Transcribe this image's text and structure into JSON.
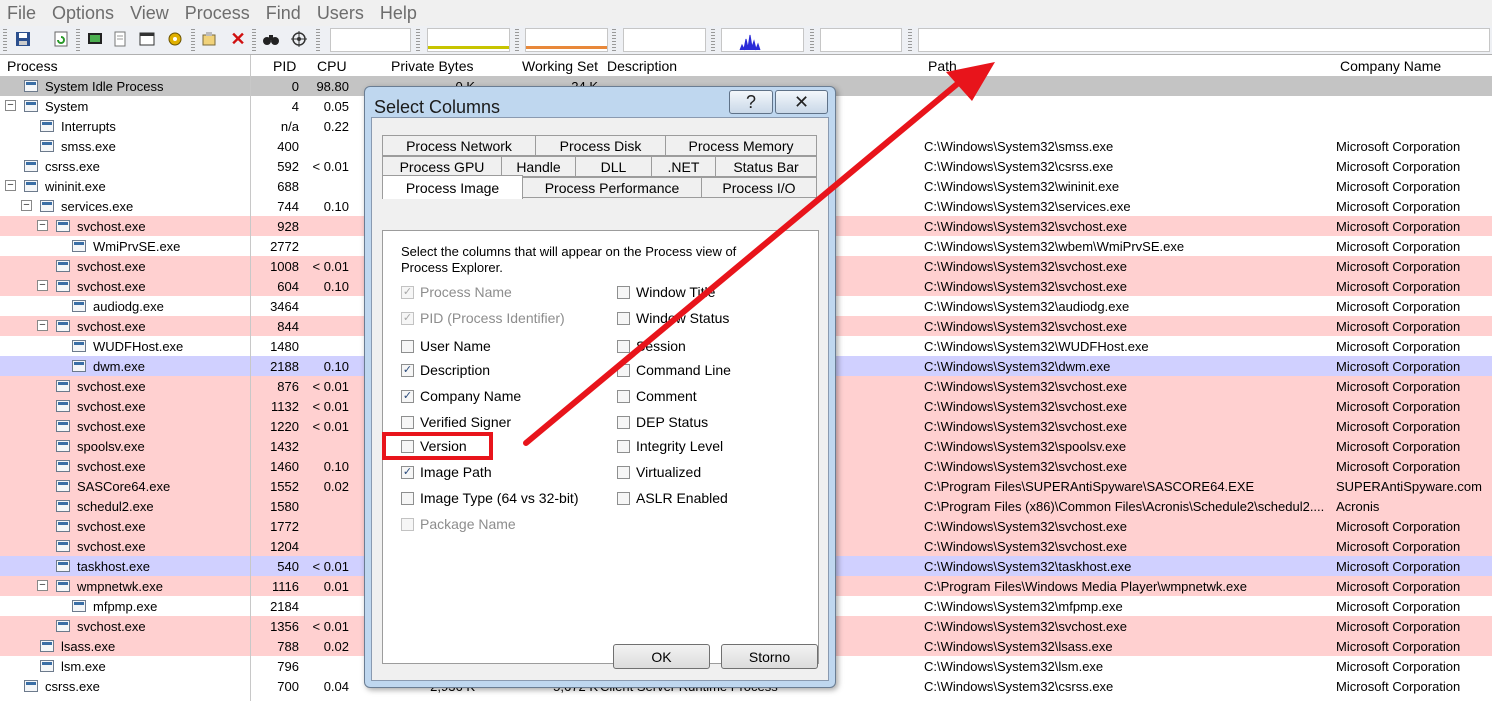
{
  "menu": [
    "File",
    "Options",
    "View",
    "Process",
    "Find",
    "Users",
    "Help"
  ],
  "columns": {
    "process": "Process",
    "pid": "PID",
    "cpu": "CPU",
    "private_bytes": "Private Bytes",
    "working_set": "Working Set",
    "description": "Description",
    "path": "Path",
    "company": "Company Name"
  },
  "processes": [
    {
      "name": "System Idle Process",
      "pid": "0",
      "cpu": "98.80",
      "priv": "0 K",
      "ws": "24 K",
      "desc": "",
      "path": "",
      "company": "",
      "tone": "gray",
      "depth": 1,
      "exp": ""
    },
    {
      "name": "System",
      "pid": "4",
      "cpu": "0.05",
      "priv": "",
      "ws": "",
      "desc": "",
      "path": "",
      "company": "",
      "tone": "",
      "depth": 1,
      "exp": "−"
    },
    {
      "name": "Interrupts",
      "pid": "n/a",
      "cpu": "0.22",
      "priv": "",
      "ws": "",
      "desc": "",
      "path": "",
      "company": "",
      "tone": "",
      "depth": 2,
      "exp": ""
    },
    {
      "name": "smss.exe",
      "pid": "400",
      "cpu": "",
      "priv": "",
      "ws": "",
      "desc": "",
      "path": "C:\\Windows\\System32\\smss.exe",
      "company": "Microsoft Corporation",
      "tone": "",
      "depth": 2,
      "exp": ""
    },
    {
      "name": "csrss.exe",
      "pid": "592",
      "cpu": "< 0.01",
      "priv": "",
      "ws": "",
      "desc": "",
      "path": "C:\\Windows\\System32\\csrss.exe",
      "company": "Microsoft Corporation",
      "tone": "",
      "depth": 1,
      "exp": ""
    },
    {
      "name": "wininit.exe",
      "pid": "688",
      "cpu": "",
      "priv": "",
      "ws": "",
      "desc": "",
      "path": "C:\\Windows\\System32\\wininit.exe",
      "company": "Microsoft Corporation",
      "tone": "",
      "depth": 1,
      "exp": "−"
    },
    {
      "name": "services.exe",
      "pid": "744",
      "cpu": "0.10",
      "priv": "",
      "ws": "",
      "desc": "",
      "path": "C:\\Windows\\System32\\services.exe",
      "company": "Microsoft Corporation",
      "tone": "",
      "depth": 2,
      "exp": "−"
    },
    {
      "name": "svchost.exe",
      "pid": "928",
      "cpu": "",
      "priv": "",
      "ws": "",
      "desc": "",
      "path": "C:\\Windows\\System32\\svchost.exe",
      "company": "Microsoft Corporation",
      "tone": "pink",
      "depth": 3,
      "exp": "−"
    },
    {
      "name": "WmiPrvSE.exe",
      "pid": "2772",
      "cpu": "",
      "priv": "",
      "ws": "",
      "desc": "",
      "path": "C:\\Windows\\System32\\wbem\\WmiPrvSE.exe",
      "company": "Microsoft Corporation",
      "tone": "",
      "depth": 4,
      "exp": ""
    },
    {
      "name": "svchost.exe",
      "pid": "1008",
      "cpu": "< 0.01",
      "priv": "",
      "ws": "",
      "desc": "",
      "path": "C:\\Windows\\System32\\svchost.exe",
      "company": "Microsoft Corporation",
      "tone": "pink",
      "depth": 3,
      "exp": ""
    },
    {
      "name": "svchost.exe",
      "pid": "604",
      "cpu": "0.10",
      "priv": "",
      "ws": "",
      "desc": "",
      "path": "C:\\Windows\\System32\\svchost.exe",
      "company": "Microsoft Corporation",
      "tone": "pink",
      "depth": 3,
      "exp": "−"
    },
    {
      "name": "audiodg.exe",
      "pid": "3464",
      "cpu": "",
      "priv": "",
      "ws": "",
      "desc": "",
      "path": "C:\\Windows\\System32\\audiodg.exe",
      "company": "Microsoft Corporation",
      "tone": "",
      "depth": 4,
      "exp": ""
    },
    {
      "name": "svchost.exe",
      "pid": "844",
      "cpu": "",
      "priv": "",
      "ws": "",
      "desc": "",
      "path": "C:\\Windows\\System32\\svchost.exe",
      "company": "Microsoft Corporation",
      "tone": "pink",
      "depth": 3,
      "exp": "−"
    },
    {
      "name": "WUDFHost.exe",
      "pid": "1480",
      "cpu": "",
      "priv": "",
      "ws": "",
      "desc": "e Driver Fra...",
      "path": "C:\\Windows\\System32\\WUDFHost.exe",
      "company": "Microsoft Corporation",
      "tone": "",
      "depth": 4,
      "exp": ""
    },
    {
      "name": "dwm.exe",
      "pid": "2188",
      "cpu": "0.10",
      "priv": "",
      "ws": "",
      "desc": "",
      "path": "C:\\Windows\\System32\\dwm.exe",
      "company": "Microsoft Corporation",
      "tone": "blue",
      "depth": 4,
      "exp": ""
    },
    {
      "name": "svchost.exe",
      "pid": "876",
      "cpu": "< 0.01",
      "priv": "",
      "ws": "",
      "desc": "",
      "path": "C:\\Windows\\System32\\svchost.exe",
      "company": "Microsoft Corporation",
      "tone": "pink",
      "depth": 3,
      "exp": ""
    },
    {
      "name": "svchost.exe",
      "pid": "1132",
      "cpu": "< 0.01",
      "priv": "",
      "ws": "",
      "desc": "",
      "path": "C:\\Windows\\System32\\svchost.exe",
      "company": "Microsoft Corporation",
      "tone": "pink",
      "depth": 3,
      "exp": ""
    },
    {
      "name": "svchost.exe",
      "pid": "1220",
      "cpu": "< 0.01",
      "priv": "",
      "ws": "",
      "desc": "",
      "path": "C:\\Windows\\System32\\svchost.exe",
      "company": "Microsoft Corporation",
      "tone": "pink",
      "depth": 3,
      "exp": ""
    },
    {
      "name": "spoolsv.exe",
      "pid": "1432",
      "cpu": "",
      "priv": "",
      "ws": "",
      "desc": "",
      "path": "C:\\Windows\\System32\\spoolsv.exe",
      "company": "Microsoft Corporation",
      "tone": "pink",
      "depth": 3,
      "exp": ""
    },
    {
      "name": "svchost.exe",
      "pid": "1460",
      "cpu": "0.10",
      "priv": "",
      "ws": "",
      "desc": "",
      "path": "C:\\Windows\\System32\\svchost.exe",
      "company": "Microsoft Corporation",
      "tone": "pink",
      "depth": 3,
      "exp": ""
    },
    {
      "name": "SASCore64.exe",
      "pid": "1552",
      "cpu": "0.02",
      "priv": "",
      "ws": "",
      "desc": "",
      "path": "C:\\Program Files\\SUPERAntiSpyware\\SASCORE64.EXE",
      "company": "SUPERAntiSpyware.com",
      "tone": "pink",
      "depth": 3,
      "exp": ""
    },
    {
      "name": "schedul2.exe",
      "pid": "1580",
      "cpu": "",
      "priv": "",
      "ws": "",
      "desc": "",
      "path": "C:\\Program Files (x86)\\Common Files\\Acronis\\Schedule2\\schedul2....",
      "company": "Acronis",
      "tone": "pink",
      "depth": 3,
      "exp": ""
    },
    {
      "name": "svchost.exe",
      "pid": "1772",
      "cpu": "",
      "priv": "",
      "ws": "",
      "desc": "",
      "path": "C:\\Windows\\System32\\svchost.exe",
      "company": "Microsoft Corporation",
      "tone": "pink",
      "depth": 3,
      "exp": ""
    },
    {
      "name": "svchost.exe",
      "pid": "1204",
      "cpu": "",
      "priv": "",
      "ws": "",
      "desc": "",
      "path": "C:\\Windows\\System32\\svchost.exe",
      "company": "Microsoft Corporation",
      "tone": "pink",
      "depth": 3,
      "exp": ""
    },
    {
      "name": "taskhost.exe",
      "pid": "540",
      "cpu": "< 0.01",
      "priv": "",
      "ws": "",
      "desc": "",
      "path": "C:\\Windows\\System32\\taskhost.exe",
      "company": "Microsoft Corporation",
      "tone": "blue",
      "depth": 3,
      "exp": ""
    },
    {
      "name": "wmpnetwk.exe",
      "pid": "1116",
      "cpu": "0.01",
      "priv": "",
      "ws": "",
      "desc": "g Service",
      "path": "C:\\Program Files\\Windows Media Player\\wmpnetwk.exe",
      "company": "Microsoft Corporation",
      "tone": "pink",
      "depth": 3,
      "exp": "−"
    },
    {
      "name": "mfpmp.exe",
      "pid": "2184",
      "cpu": "",
      "priv": "",
      "ws": "",
      "desc": "XE",
      "path": "C:\\Windows\\System32\\mfpmp.exe",
      "company": "Microsoft Corporation",
      "tone": "",
      "depth": 4,
      "exp": ""
    },
    {
      "name": "svchost.exe",
      "pid": "1356",
      "cpu": "< 0.01",
      "priv": "",
      "ws": "",
      "desc": "",
      "path": "C:\\Windows\\System32\\svchost.exe",
      "company": "Microsoft Corporation",
      "tone": "pink",
      "depth": 3,
      "exp": ""
    },
    {
      "name": "lsass.exe",
      "pid": "788",
      "cpu": "0.02",
      "priv": "",
      "ws": "",
      "desc": "",
      "path": "C:\\Windows\\System32\\lsass.exe",
      "company": "Microsoft Corporation",
      "tone": "pink",
      "depth": 2,
      "exp": ""
    },
    {
      "name": "lsm.exe",
      "pid": "796",
      "cpu": "",
      "priv": "",
      "ws": "",
      "desc": "",
      "path": "C:\\Windows\\System32\\lsm.exe",
      "company": "Microsoft Corporation",
      "tone": "",
      "depth": 2,
      "exp": ""
    },
    {
      "name": "csrss.exe",
      "pid": "700",
      "cpu": "0.04",
      "priv": "2,936 K",
      "ws": "5,672 K",
      "desc": "Client Server Runtime Process",
      "path": "C:\\Windows\\System32\\csrss.exe",
      "company": "Microsoft Corporation",
      "tone": "",
      "depth": 1,
      "exp": ""
    }
  ],
  "dialog": {
    "title": "Select Columns",
    "help": "?",
    "close": "✕",
    "tabs_row1": [
      "Process Network",
      "Process Disk",
      "Process Memory"
    ],
    "tabs_row2": [
      "Process GPU",
      "Handle",
      "DLL",
      ".NET",
      "Status Bar"
    ],
    "tabs_row3": [
      "Process Image",
      "Process Performance",
      "Process I/O"
    ],
    "active_tab": "Process Image",
    "description": "Select the columns that will appear on the Process view of Process Explorer.",
    "left_options": [
      {
        "label": "Process Name",
        "checked": true,
        "disabled": true
      },
      {
        "label": "PID (Process Identifier)",
        "checked": true,
        "disabled": true
      },
      {
        "label": "User Name",
        "checked": false,
        "disabled": false
      },
      {
        "label": "Description",
        "checked": true,
        "disabled": false
      },
      {
        "label": "Company Name",
        "checked": true,
        "disabled": false
      },
      {
        "label": "Verified Signer",
        "checked": false,
        "disabled": false
      },
      {
        "label": "Version",
        "checked": false,
        "disabled": false
      },
      {
        "label": "Image Path",
        "checked": true,
        "disabled": false
      },
      {
        "label": "Image Type (64 vs 32-bit)",
        "checked": false,
        "disabled": false
      },
      {
        "label": "Package Name",
        "checked": false,
        "disabled": true
      }
    ],
    "right_options": [
      {
        "label": "Window Title",
        "checked": false
      },
      {
        "label": "Window Status",
        "checked": false
      },
      {
        "label": "Session",
        "checked": false
      },
      {
        "label": "Command Line",
        "checked": false
      },
      {
        "label": "Comment",
        "checked": false
      },
      {
        "label": "DEP Status",
        "checked": false
      },
      {
        "label": "Integrity Level",
        "checked": false
      },
      {
        "label": "Virtualized",
        "checked": false
      },
      {
        "label": "ASLR Enabled",
        "checked": false
      }
    ],
    "ok": "OK",
    "cancel": "Storno"
  },
  "annotation_color": "#e8141b"
}
